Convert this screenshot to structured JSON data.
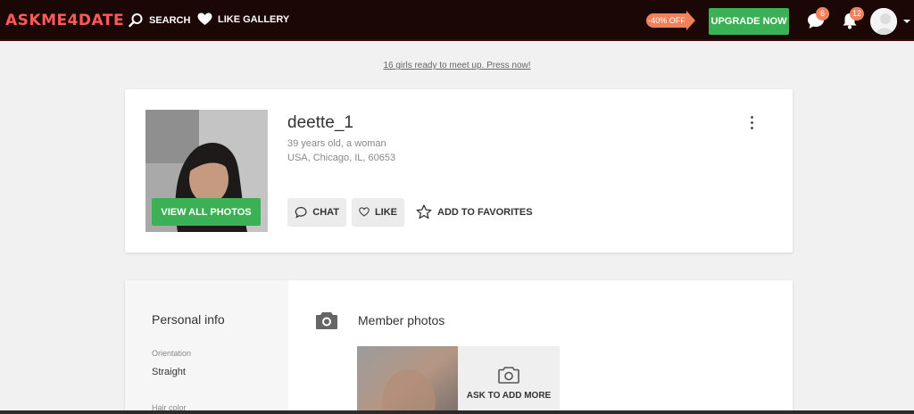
{
  "header": {
    "logo": "ASKME4DATE",
    "nav": {
      "search": "SEARCH",
      "like_gallery": "LIKE GALLERY"
    },
    "promo": "-40% OFF",
    "upgrade": "UPGRADE NOW",
    "messages_count": "6",
    "notifications_count": "12"
  },
  "banner": {
    "link_text": "16 girls ready to meet up. Press now!"
  },
  "profile": {
    "username": "deette_1",
    "age_gender": "39 years old, a woman",
    "location": "USA, Chicago, IL, 60653",
    "view_photos": "VIEW ALL PHOTOS",
    "actions": {
      "chat": "CHAT",
      "like": "LIKE",
      "favorites": "ADD TO FAVORITES"
    }
  },
  "personal_info": {
    "title": "Personal info",
    "fields": [
      {
        "label": "Orientation",
        "value": "Straight"
      },
      {
        "label": "Hair color",
        "value": ""
      }
    ]
  },
  "member_photos": {
    "title": "Member photos",
    "ask_more": "ASK TO ADD MORE"
  },
  "colors": {
    "topbar": "#1c0707",
    "logo": "#ff5a5a",
    "green": "#3cb054",
    "promo": "#f0825b",
    "background": "#f1f1f1"
  }
}
